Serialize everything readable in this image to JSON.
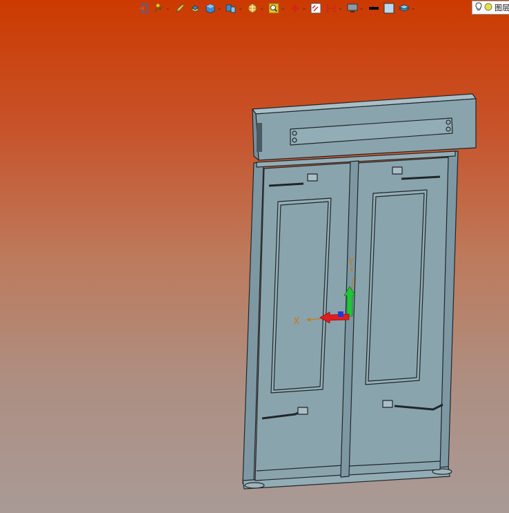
{
  "toolbar": {
    "tools": [
      {
        "name": "exit-sketch",
        "icon": "exit-icon",
        "dropdown": false
      },
      {
        "name": "snap-tools",
        "icon": "snap-icon",
        "dropdown": true
      },
      {
        "name": "edit-tool",
        "icon": "pencil-icon",
        "dropdown": false
      },
      {
        "name": "extrude",
        "icon": "extrude-icon",
        "dropdown": false
      },
      {
        "name": "solid-box",
        "icon": "box-icon",
        "dropdown": true
      },
      {
        "name": "view-orientation",
        "icon": "views-icon",
        "dropdown": true
      },
      {
        "name": "render-style",
        "icon": "render-icon",
        "dropdown": true
      },
      {
        "name": "zoom",
        "icon": "zoom-icon",
        "dropdown": true
      },
      {
        "name": "origin",
        "icon": "crosshair-icon",
        "dropdown": true
      },
      {
        "name": "section",
        "icon": "section-icon",
        "dropdown": false
      },
      {
        "name": "dimension",
        "icon": "dimension-icon",
        "dropdown": true
      },
      {
        "name": "display",
        "icon": "monitor-icon",
        "dropdown": true
      },
      {
        "name": "line-color",
        "icon": "black-swatch-icon",
        "dropdown": false
      },
      {
        "name": "fill-color",
        "icon": "light-swatch-icon",
        "dropdown": false
      },
      {
        "name": "layers",
        "icon": "layers-icon",
        "dropdown": true
      }
    ],
    "search_text": "图层"
  },
  "colors": {
    "background_top": "#cc3a00",
    "background_bottom": "#a99a96",
    "model_fill": "#8aa4ae",
    "model_edge": "#1e2628",
    "axis_x": "#e01e1e",
    "axis_y": "#22c43a",
    "axis_label": "#c87b14"
  },
  "axes": {
    "x_label": "X",
    "y_label": "Y"
  }
}
